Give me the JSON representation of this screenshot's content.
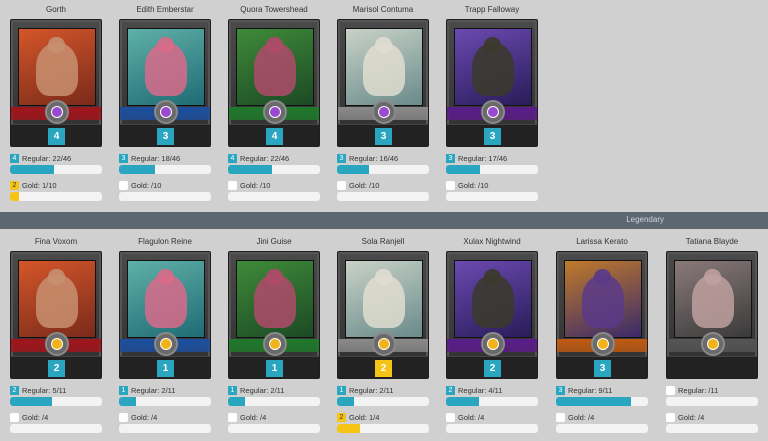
{
  "colors": {
    "background": "#d0d0d0",
    "regular_bar": "#2aa6c1",
    "gold_bar": "#f6c414",
    "divider": "#5c6770"
  },
  "section_label": "Legendary",
  "row1": [
    {
      "name": "Gorth",
      "level": "4",
      "regular_badge": "4",
      "regular": "Regular: 22/46",
      "regular_frac": 0.478,
      "gold_badge": "2",
      "gold": "Gold: 1/10",
      "gold_frac": 0.1,
      "element": "red",
      "gem_icon": "purple-gem-icon"
    },
    {
      "name": "Edith Emberstar",
      "level": "3",
      "regular_badge": "3",
      "regular": "Regular: 18/46",
      "regular_frac": 0.391,
      "gold_badge": "",
      "gold": "Gold: /10",
      "gold_frac": 0,
      "element": "blue",
      "gem_icon": "purple-gem-icon"
    },
    {
      "name": "Quora Towershead",
      "level": "4",
      "regular_badge": "4",
      "regular": "Regular: 22/46",
      "regular_frac": 0.478,
      "gold_badge": "",
      "gold": "Gold: /10",
      "gold_frac": 0,
      "element": "green",
      "gem_icon": "purple-gem-icon"
    },
    {
      "name": "Marisol Contuma",
      "level": "3",
      "regular_badge": "3",
      "regular": "Regular: 16/46",
      "regular_frac": 0.348,
      "gold_badge": "",
      "gold": "Gold: /10",
      "gold_frac": 0,
      "element": "white",
      "gem_icon": "purple-gem-icon"
    },
    {
      "name": "Trapp Falloway",
      "level": "3",
      "regular_badge": "3",
      "regular": "Regular: 17/46",
      "regular_frac": 0.37,
      "gold_badge": "",
      "gold": "Gold: /10",
      "gold_frac": 0,
      "element": "purple",
      "gem_icon": "purple-gem-icon"
    }
  ],
  "row2": [
    {
      "name": "Fina Voxom",
      "level": "2",
      "regular_badge": "2",
      "regular": "Regular: 5/11",
      "regular_frac": 0.455,
      "gold_badge": "",
      "gold": "Gold: /4",
      "gold_frac": 0,
      "element": "red",
      "gem_icon": "gold-gem-icon"
    },
    {
      "name": "Flagulon Reine",
      "level": "1",
      "regular_badge": "1",
      "regular": "Regular: 2/11",
      "regular_frac": 0.182,
      "gold_badge": "",
      "gold": "Gold: /4",
      "gold_frac": 0,
      "element": "blue",
      "gem_icon": "gold-gem-icon"
    },
    {
      "name": "Jini Guise",
      "level": "1",
      "regular_badge": "1",
      "regular": "Regular: 2/11",
      "regular_frac": 0.182,
      "gold_badge": "",
      "gold": "Gold: /4",
      "gold_frac": 0,
      "element": "green",
      "gem_icon": "gold-gem-icon"
    },
    {
      "name": "Sola Ranjell",
      "level": "2",
      "regular_badge": "1",
      "regular": "Regular: 2/11",
      "regular_frac": 0.182,
      "gold_badge": "2",
      "gold": "Gold: 1/4",
      "gold_frac": 0.25,
      "element": "white",
      "level_gold": true,
      "gem_icon": "gold-gem-icon"
    },
    {
      "name": "Xulax Nightwind",
      "level": "2",
      "regular_badge": "2",
      "regular": "Regular: 4/11",
      "regular_frac": 0.364,
      "gold_badge": "",
      "gold": "Gold: /4",
      "gold_frac": 0,
      "element": "purple",
      "gem_icon": "gold-gem-icon"
    },
    {
      "name": "Larissa Kerato",
      "level": "3",
      "regular_badge": "3",
      "regular": "Regular: 9/11",
      "regular_frac": 0.818,
      "gold_badge": "",
      "gold": "Gold: /4",
      "gold_frac": 0,
      "element": "orange",
      "gem_icon": "gold-gem-icon"
    },
    {
      "name": "Tatiana Blayde",
      "level": "",
      "regular_badge": "",
      "regular": "Regular: /11",
      "regular_frac": 0,
      "gold_badge": "",
      "gold": "Gold: /4",
      "gold_frac": 0,
      "element": "gray",
      "gem_icon": "gold-gem-icon"
    }
  ]
}
